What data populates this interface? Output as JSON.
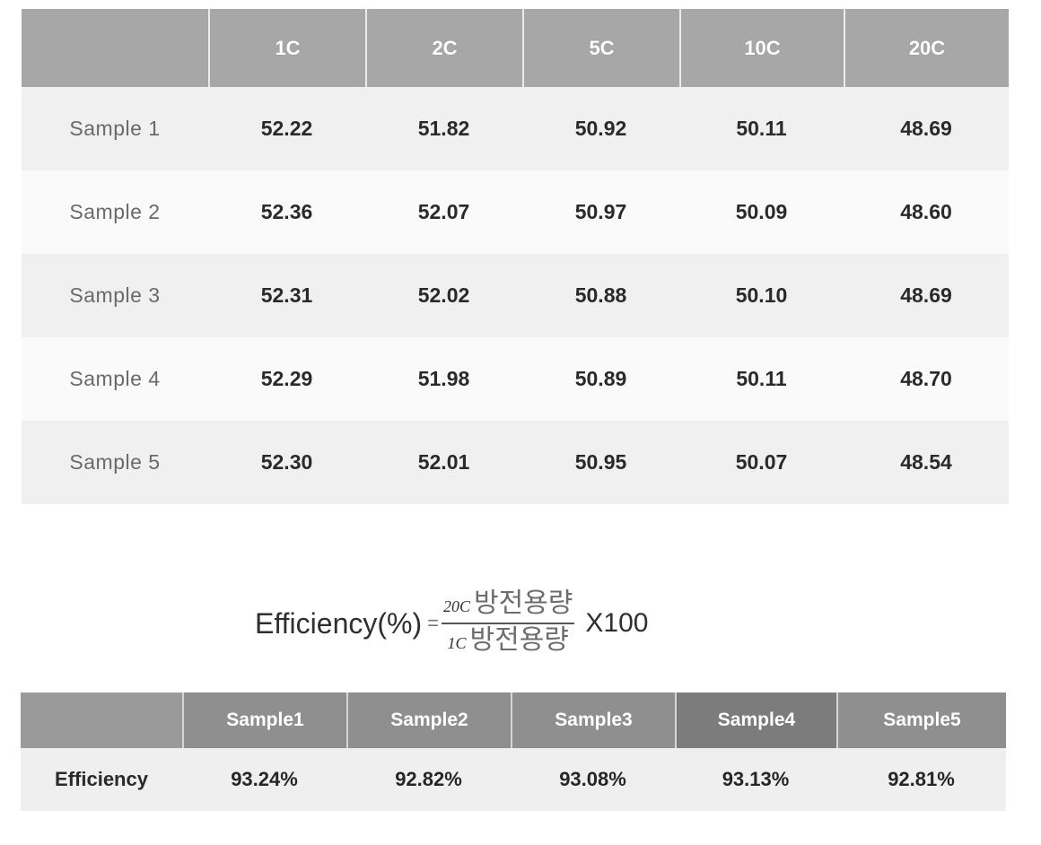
{
  "rate_table": {
    "corner": "",
    "columns": [
      "1C",
      "2C",
      "5C",
      "10C",
      "20C"
    ],
    "rows": [
      {
        "label": "Sample 1",
        "values": [
          "52.22",
          "51.82",
          "50.92",
          "50.11",
          "48.69"
        ]
      },
      {
        "label": "Sample 2",
        "values": [
          "52.36",
          "52.07",
          "50.97",
          "50.09",
          "48.60"
        ]
      },
      {
        "label": "Sample 3",
        "values": [
          "52.31",
          "52.02",
          "50.88",
          "50.10",
          "48.69"
        ]
      },
      {
        "label": "Sample 4",
        "values": [
          "52.29",
          "51.98",
          "50.89",
          "50.11",
          "48.70"
        ]
      },
      {
        "label": "Sample 5",
        "values": [
          "52.30",
          "52.01",
          "50.95",
          "50.07",
          "48.54"
        ]
      }
    ]
  },
  "formula": {
    "lhs": "Efficiency(%)",
    "equals": "=",
    "numerator_rate": "20C",
    "numerator_text": "방전용량",
    "denominator_rate": "1C",
    "denominator_text": "방전용량",
    "multiplier": "X100"
  },
  "efficiency_table": {
    "corner": "",
    "columns": [
      "Sample1",
      "Sample2",
      "Sample3",
      "Sample4",
      "Sample5"
    ],
    "row_label": "Efficiency",
    "values": [
      "93.24%",
      "92.82%",
      "93.08%",
      "93.13%",
      "92.81%"
    ]
  }
}
